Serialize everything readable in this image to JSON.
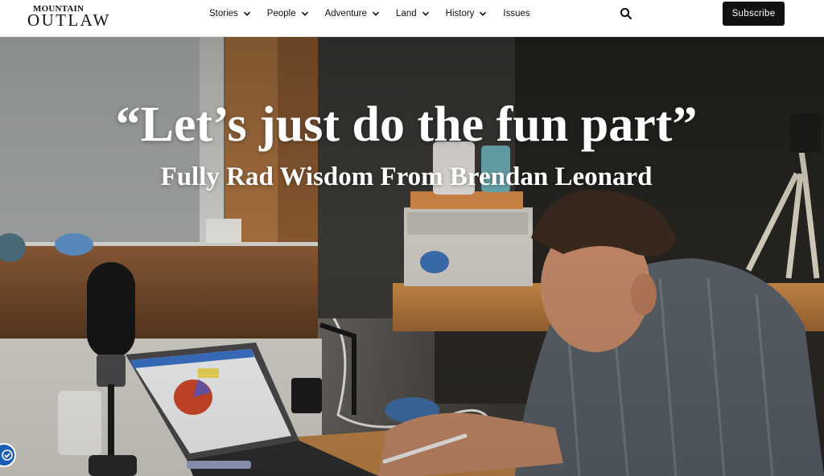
{
  "header": {
    "logo": {
      "top": "MOUNTAIN",
      "bottom": "OUTLAW"
    },
    "nav": [
      {
        "label": "Stories",
        "has_dropdown": true
      },
      {
        "label": "People",
        "has_dropdown": true
      },
      {
        "label": "Adventure",
        "has_dropdown": true
      },
      {
        "label": "Land",
        "has_dropdown": true
      },
      {
        "label": "History",
        "has_dropdown": true
      },
      {
        "label": "Issues",
        "has_dropdown": false
      }
    ],
    "search_icon": "search-icon",
    "subscribe_label": "Subscribe"
  },
  "hero": {
    "title": "“Let’s just do the fun part”",
    "subtitle": "Fully Rad Wisdom From Brendan Leonard",
    "image": "man-with-stylus-at-desk-photo"
  },
  "accessibility_icon": "accessibility-icon",
  "colors": {
    "header_bg": "#ffffff",
    "subscribe_bg": "#111111",
    "text_dark": "#111111",
    "hero_text": "#ffffff",
    "accessibility_bg": "#1a5fb4"
  }
}
